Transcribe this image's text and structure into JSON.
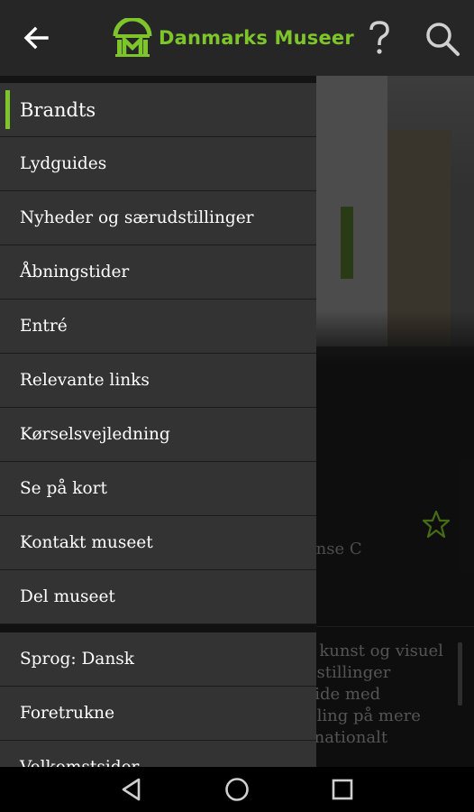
{
  "app": {
    "brand": "Danmarks Museer",
    "accent_color": "#7dc52a"
  },
  "appbar": {
    "back_icon": "arrow-left-icon",
    "help_icon": "question-mark-icon",
    "search_icon": "search-icon"
  },
  "drawer": {
    "header": "Brandts",
    "items": [
      {
        "label": "Lydguides"
      },
      {
        "label": "Nyheder og særudstillinger"
      },
      {
        "label": "Åbningstider"
      },
      {
        "label": "Entré"
      },
      {
        "label": "Relevante links"
      },
      {
        "label": "Kørselsvejledning"
      },
      {
        "label": "Se på kort"
      },
      {
        "label": "Kontakt museet"
      },
      {
        "label": "Del museet"
      }
    ],
    "settings": [
      {
        "label": "Sprog: Dansk"
      },
      {
        "label": "Foretrukne"
      },
      {
        "label": "Velkomstsider"
      }
    ]
  },
  "background": {
    "subtitle_fragment": "ense C",
    "description_lines": [
      "r kunst og visuel",
      "dstillinger",
      "side med",
      "nling på mere",
      "rnationalt",
      "…"
    ]
  },
  "navbar": {
    "back_icon": "triangle-back-icon",
    "home_icon": "circle-home-icon",
    "recents_icon": "square-recents-icon"
  }
}
